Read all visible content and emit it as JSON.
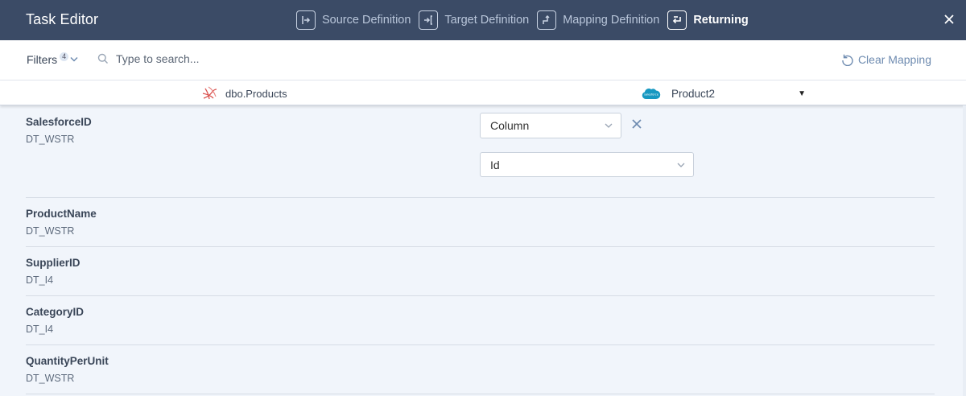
{
  "header": {
    "title": "Task Editor",
    "steps": [
      {
        "label": "Source Definition",
        "icon": "source-definition-icon"
      },
      {
        "label": "Target Definition",
        "icon": "target-definition-icon"
      },
      {
        "label": "Mapping Definition",
        "icon": "mapping-definition-icon"
      },
      {
        "label": "Returning",
        "icon": "returning-icon",
        "active": true
      }
    ]
  },
  "filterbar": {
    "filters_label": "Filters",
    "filters_count": "4",
    "search_placeholder": "Type to search...",
    "search_value": "",
    "clear_mapping_label": "Clear Mapping"
  },
  "objects": {
    "source_name": "dbo.Products",
    "source_icon": "sql-server-icon",
    "target_name": "Product2",
    "target_icon": "salesforce-icon"
  },
  "fields": [
    {
      "name": "SalesforceID",
      "type": "DT_WSTR",
      "mapping_type": "Column",
      "mapping_value": "Id"
    },
    {
      "name": "ProductName",
      "type": "DT_WSTR"
    },
    {
      "name": "SupplierID",
      "type": "DT_I4"
    },
    {
      "name": "CategoryID",
      "type": "DT_I4"
    },
    {
      "name": "QuantityPerUnit",
      "type": "DT_WSTR"
    }
  ],
  "colors": {
    "header_bg": "#3b4b66",
    "accent": "#6e8bb0",
    "body_bg": "#f1f5fb"
  }
}
